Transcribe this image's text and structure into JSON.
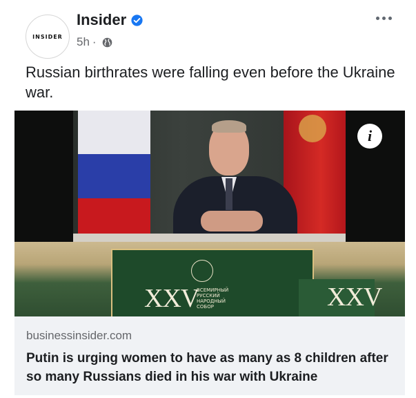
{
  "post": {
    "avatar_text": "INSIDER",
    "page_name": "Insider",
    "verified": true,
    "timestamp": "5h",
    "separator": "·",
    "audience_icon": "globe-icon",
    "more_icon": "more-options-icon",
    "caption": "Russian birthrates were falling even before the Ukraine war."
  },
  "media": {
    "info_label": "i",
    "stage_text_left": "XXV",
    "stage_text_right": "XXV",
    "stage_small_text": "ВСЕМИРНЫЙ\nРУССКИЙ\nНАРОДНЫЙ\nСОБОР"
  },
  "link_preview": {
    "domain": "businessinsider.com",
    "headline": "Putin is urging women to have as many as 8 children after so many Russians died in his war with Ukraine"
  },
  "colors": {
    "verified_blue": "#1877f2",
    "secondary_text": "#65676b",
    "preview_bg": "#f0f2f5"
  }
}
